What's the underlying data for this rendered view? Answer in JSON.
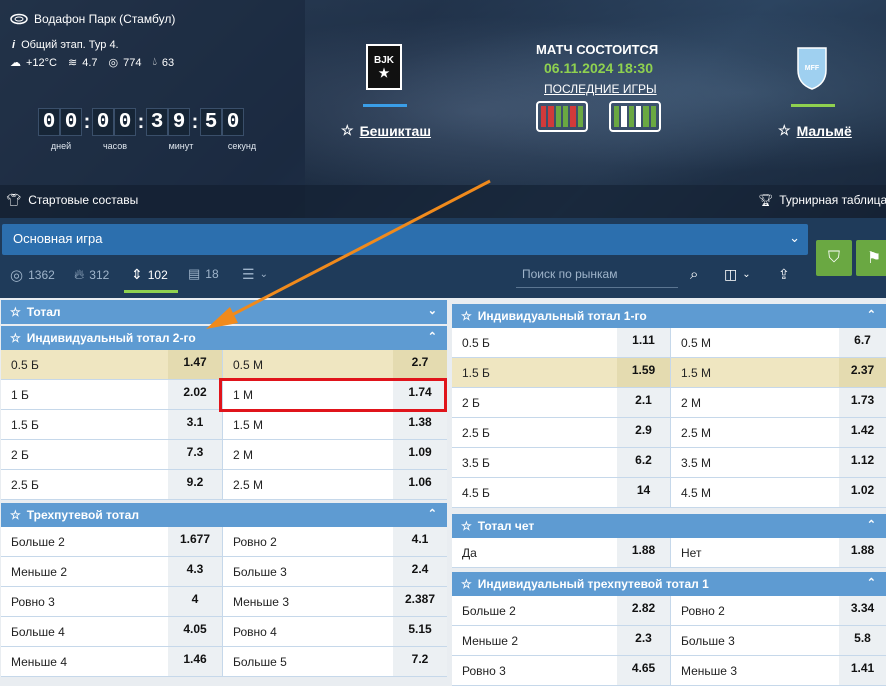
{
  "match": {
    "venue": "Водафон Парк (Стамбул)",
    "stage": "Общий этап. Тур 4.",
    "weather": {
      "temp": "+12°C",
      "wind": "4.7",
      "pressure": "774",
      "humidity": "63"
    },
    "timer": {
      "digits": [
        "0",
        "0",
        "0",
        "0",
        "3",
        "9",
        "5",
        "0"
      ],
      "labels": [
        "дней",
        "часов",
        "минут",
        "секунд"
      ]
    },
    "home": "Бешикташ",
    "away": "Мальмё",
    "status": "МАТЧ СОСТОИТСЯ",
    "datetime": "06.11.2024 18:30",
    "last_games": "ПОСЛЕДНИЕ ИГРЫ",
    "lineups": "Стартовые составы",
    "standings": "Турнирная таблица",
    "colors": {
      "accent": "#5e9bd2",
      "win": "#6aa842",
      "loss": "#d03a3a",
      "date": "#8fd14f"
    }
  },
  "main_game": "Основная игра",
  "toolbar": {
    "counts": [
      "1362",
      "312",
      "102",
      "18"
    ],
    "search_placeholder": "Поиск по рынкам"
  },
  "left": {
    "total": "Тотал",
    "ind2": {
      "title": "Индивидуальный тотал 2-го",
      "rows": [
        {
          "l1": "0.5 Б",
          "o1": "1.47",
          "l2": "0.5 М",
          "o2": "2.7"
        },
        {
          "l1": "1 Б",
          "o1": "2.02",
          "l2": "1 М",
          "o2": "1.74"
        },
        {
          "l1": "1.5 Б",
          "o1": "3.1",
          "l2": "1.5 М",
          "o2": "1.38"
        },
        {
          "l1": "2 Б",
          "o1": "7.3",
          "l2": "2 М",
          "o2": "1.09"
        },
        {
          "l1": "2.5 Б",
          "o1": "9.2",
          "l2": "2.5 М",
          "o2": "1.06"
        }
      ]
    },
    "three": {
      "title": "Трехпутевой тотал",
      "rows": [
        {
          "l1": "Больше 2",
          "o1": "1.677",
          "l2": "Ровно 2",
          "o2": "4.1"
        },
        {
          "l1": "Меньше 2",
          "o1": "4.3",
          "l2": "Больше 3",
          "o2": "2.4"
        },
        {
          "l1": "Ровно 3",
          "o1": "4",
          "l2": "Меньше 3",
          "o2": "2.387"
        },
        {
          "l1": "Больше 4",
          "o1": "4.05",
          "l2": "Ровно 4",
          "o2": "5.15"
        },
        {
          "l1": "Меньше 4",
          "o1": "1.46",
          "l2": "Больше 5",
          "o2": "7.2"
        }
      ]
    }
  },
  "right": {
    "ind1": {
      "title": "Индивидуальный тотал 1-го",
      "rows": [
        {
          "l1": "0.5 Б",
          "o1": "1.11",
          "l2": "0.5 М",
          "o2": "6.7"
        },
        {
          "l1": "1.5 Б",
          "o1": "1.59",
          "l2": "1.5 М",
          "o2": "2.37"
        },
        {
          "l1": "2 Б",
          "o1": "2.1",
          "l2": "2 М",
          "o2": "1.73"
        },
        {
          "l1": "2.5 Б",
          "o1": "2.9",
          "l2": "2.5 М",
          "o2": "1.42"
        },
        {
          "l1": "3.5 Б",
          "o1": "6.2",
          "l2": "3.5 М",
          "o2": "1.12"
        },
        {
          "l1": "4.5 Б",
          "o1": "14",
          "l2": "4.5 М",
          "o2": "1.02"
        }
      ]
    },
    "even": {
      "title": "Тотал чет",
      "rows": [
        {
          "l1": "Да",
          "o1": "1.88",
          "l2": "Нет",
          "o2": "1.88"
        }
      ]
    },
    "three1": {
      "title": "Индивидуальный трехпутевой тотал 1",
      "rows": [
        {
          "l1": "Больше 2",
          "o1": "2.82",
          "l2": "Ровно 2",
          "o2": "3.34"
        },
        {
          "l1": "Меньше 2",
          "o1": "2.3",
          "l2": "Больше 3",
          "o2": "5.8"
        },
        {
          "l1": "Ровно 3",
          "o1": "4.65",
          "l2": "Меньше 3",
          "o2": "1.41"
        }
      ]
    }
  }
}
